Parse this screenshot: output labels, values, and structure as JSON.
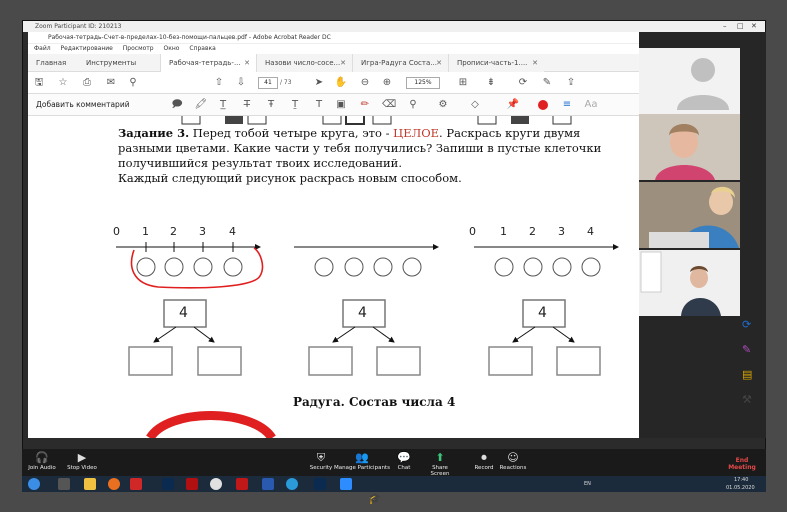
{
  "zoom": {
    "title": "Zoom Participant ID: 210213",
    "controls": {
      "join_audio": "Join Audio",
      "stop_video": "Stop Video",
      "security": "Security",
      "manage_participants": "Manage Participants",
      "chat": "Chat",
      "share_screen": "Share Screen",
      "record": "Record",
      "reactions": "Reactions",
      "end_meeting": "End Meeting"
    }
  },
  "acrobat": {
    "title": "Рабочая-тетрадь-Счет-в-пределах-10-без-помощи-пальцев.pdf - Adobe Acrobat Reader DC",
    "menu": [
      "Файл",
      "Редактирование",
      "Просмотр",
      "Окно",
      "Справка"
    ],
    "tabs": {
      "home": "Главная",
      "tools": "Инструменты",
      "docs": [
        "Рабочая-тетрадь-...",
        "Назови число-сосе...",
        "Игра-Радуга Соста...",
        "Прописи-часть-1...."
      ]
    },
    "page_current": "41",
    "page_total": "/ 73",
    "zoom_level": "125%",
    "comment_label": "Добавить комментарий"
  },
  "document": {
    "task_title": "Задание 3.",
    "task_line1_a": "Перед тобой четыре круга, это - ",
    "task_line1_red": "ЦЕЛОЕ",
    "task_line1_b": ". Раскрась круги двумя",
    "task_line2": "разными цветами. Какие части у тебя получились? Запиши в пустые клеточки",
    "task_line3": "получившийся результат твоих исследований.",
    "task_line4": "Каждый следующий рисунок раскрась новым способом.",
    "number_line_labels": [
      "0",
      "1",
      "2",
      "3",
      "4"
    ],
    "whole_value": "4",
    "caption": "Радуга. Состав числа 4"
  },
  "taskbar": {
    "lang": "EN",
    "time": "17:40",
    "date": "01.05.2020"
  },
  "colors": {
    "accent_red": "#e02020",
    "zoom_bg": "#1a1a1a",
    "taskbar_bg": "#1b2b3b"
  }
}
